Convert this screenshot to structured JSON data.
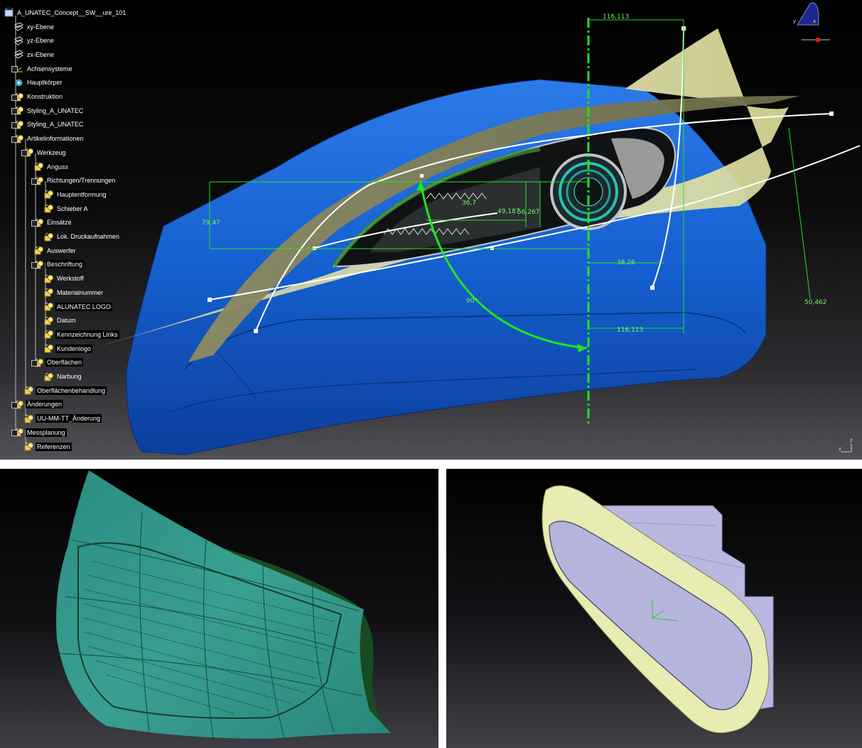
{
  "tree": {
    "root_label": "A_UNATEC_Concept__SW__ure_101",
    "items": [
      {
        "label": "xy-Ebene",
        "level": 1,
        "icon": "plane-icon"
      },
      {
        "label": "yz-Ebene",
        "level": 1,
        "icon": "plane-icon"
      },
      {
        "label": "zx-Ebene",
        "level": 1,
        "icon": "plane-icon"
      },
      {
        "label": "Achsensysteme",
        "level": 1,
        "icon": "axis-system-icon"
      },
      {
        "label": "Hauptkörper",
        "level": 1,
        "icon": "part-body-icon"
      },
      {
        "label": "Konstruktion",
        "level": 1,
        "icon": "geometric-set-icon"
      },
      {
        "label": "Styling_A_UNATEC",
        "level": 1,
        "icon": "geometric-set-icon"
      },
      {
        "label": "Styling_A_UNATEC",
        "level": 1,
        "icon": "geometric-set-icon"
      },
      {
        "label": "Artikelinformationen",
        "level": 1,
        "icon": "geometric-set-icon"
      },
      {
        "label": "Werkzeug",
        "level": 2,
        "icon": "geometric-set-icon"
      },
      {
        "label": "Anguss",
        "level": 3,
        "icon": "geometric-set-icon"
      },
      {
        "label": "Richtungen/Trennungen",
        "level": 3,
        "icon": "geometric-set-icon"
      },
      {
        "label": "Hauptentformung",
        "level": 4,
        "icon": "geometric-set-icon"
      },
      {
        "label": "Schieber A",
        "level": 4,
        "icon": "geometric-set-icon"
      },
      {
        "label": "Einsätze",
        "level": 3,
        "icon": "geometric-set-icon"
      },
      {
        "label": "Lok. Druckaufnahmen",
        "level": 4,
        "icon": "geometric-set-icon"
      },
      {
        "label": "Auswerfer",
        "level": 3,
        "icon": "geometric-set-icon"
      },
      {
        "label": "Beschriftung",
        "level": 3,
        "icon": "geometric-set-icon"
      },
      {
        "label": "Werkstoff",
        "level": 4,
        "icon": "geometric-set-icon"
      },
      {
        "label": "Materialnummer",
        "level": 4,
        "icon": "geometric-set-icon"
      },
      {
        "label": "ALUNATEC LOGO",
        "level": 4,
        "icon": "geometric-set-icon"
      },
      {
        "label": "Datum",
        "level": 4,
        "icon": "geometric-set-icon"
      },
      {
        "label": "Kennzeichnung Links",
        "level": 4,
        "icon": "geometric-set-icon"
      },
      {
        "label": "Kundenlogo",
        "level": 4,
        "icon": "geometric-set-icon"
      },
      {
        "label": "Oberflächen",
        "level": 3,
        "icon": "geometric-set-icon"
      },
      {
        "label": "Narbung",
        "level": 4,
        "icon": "geometric-set-icon"
      },
      {
        "label": "Oberflächenbehandlung",
        "level": 2,
        "icon": "geometric-set-icon"
      },
      {
        "label": "Änderungen",
        "level": 1,
        "icon": "geometric-set-icon"
      },
      {
        "label": "UU-MM-TT_Änderung",
        "level": 2,
        "icon": "geometric-set-icon"
      },
      {
        "label": "Messplanung",
        "level": 1,
        "icon": "geometric-set-icon"
      },
      {
        "label": "Referenzen",
        "level": 2,
        "icon": "geometric-set-icon"
      }
    ]
  },
  "dimensions": {
    "top_width": "116,113",
    "bottom_width": "116,113",
    "left_height": "79,47",
    "diagonal": "50,462",
    "angle": "90°",
    "offset": "38,26",
    "inner_1": "49,187",
    "inner_2": "56,267",
    "inner_3": "36,7"
  },
  "compass": {
    "x_label": "x",
    "y_label": "y"
  },
  "axis_triad": {
    "z_label": "z",
    "x_label": "x"
  },
  "colors": {
    "body_blue": "#1a5fd0",
    "parting_surface": "#e4e4a8",
    "measurement_green": "#22e022",
    "left_part": "#2f9e8a",
    "right_insert": "#b3b3dc",
    "right_rim": "#e9ecb0"
  }
}
